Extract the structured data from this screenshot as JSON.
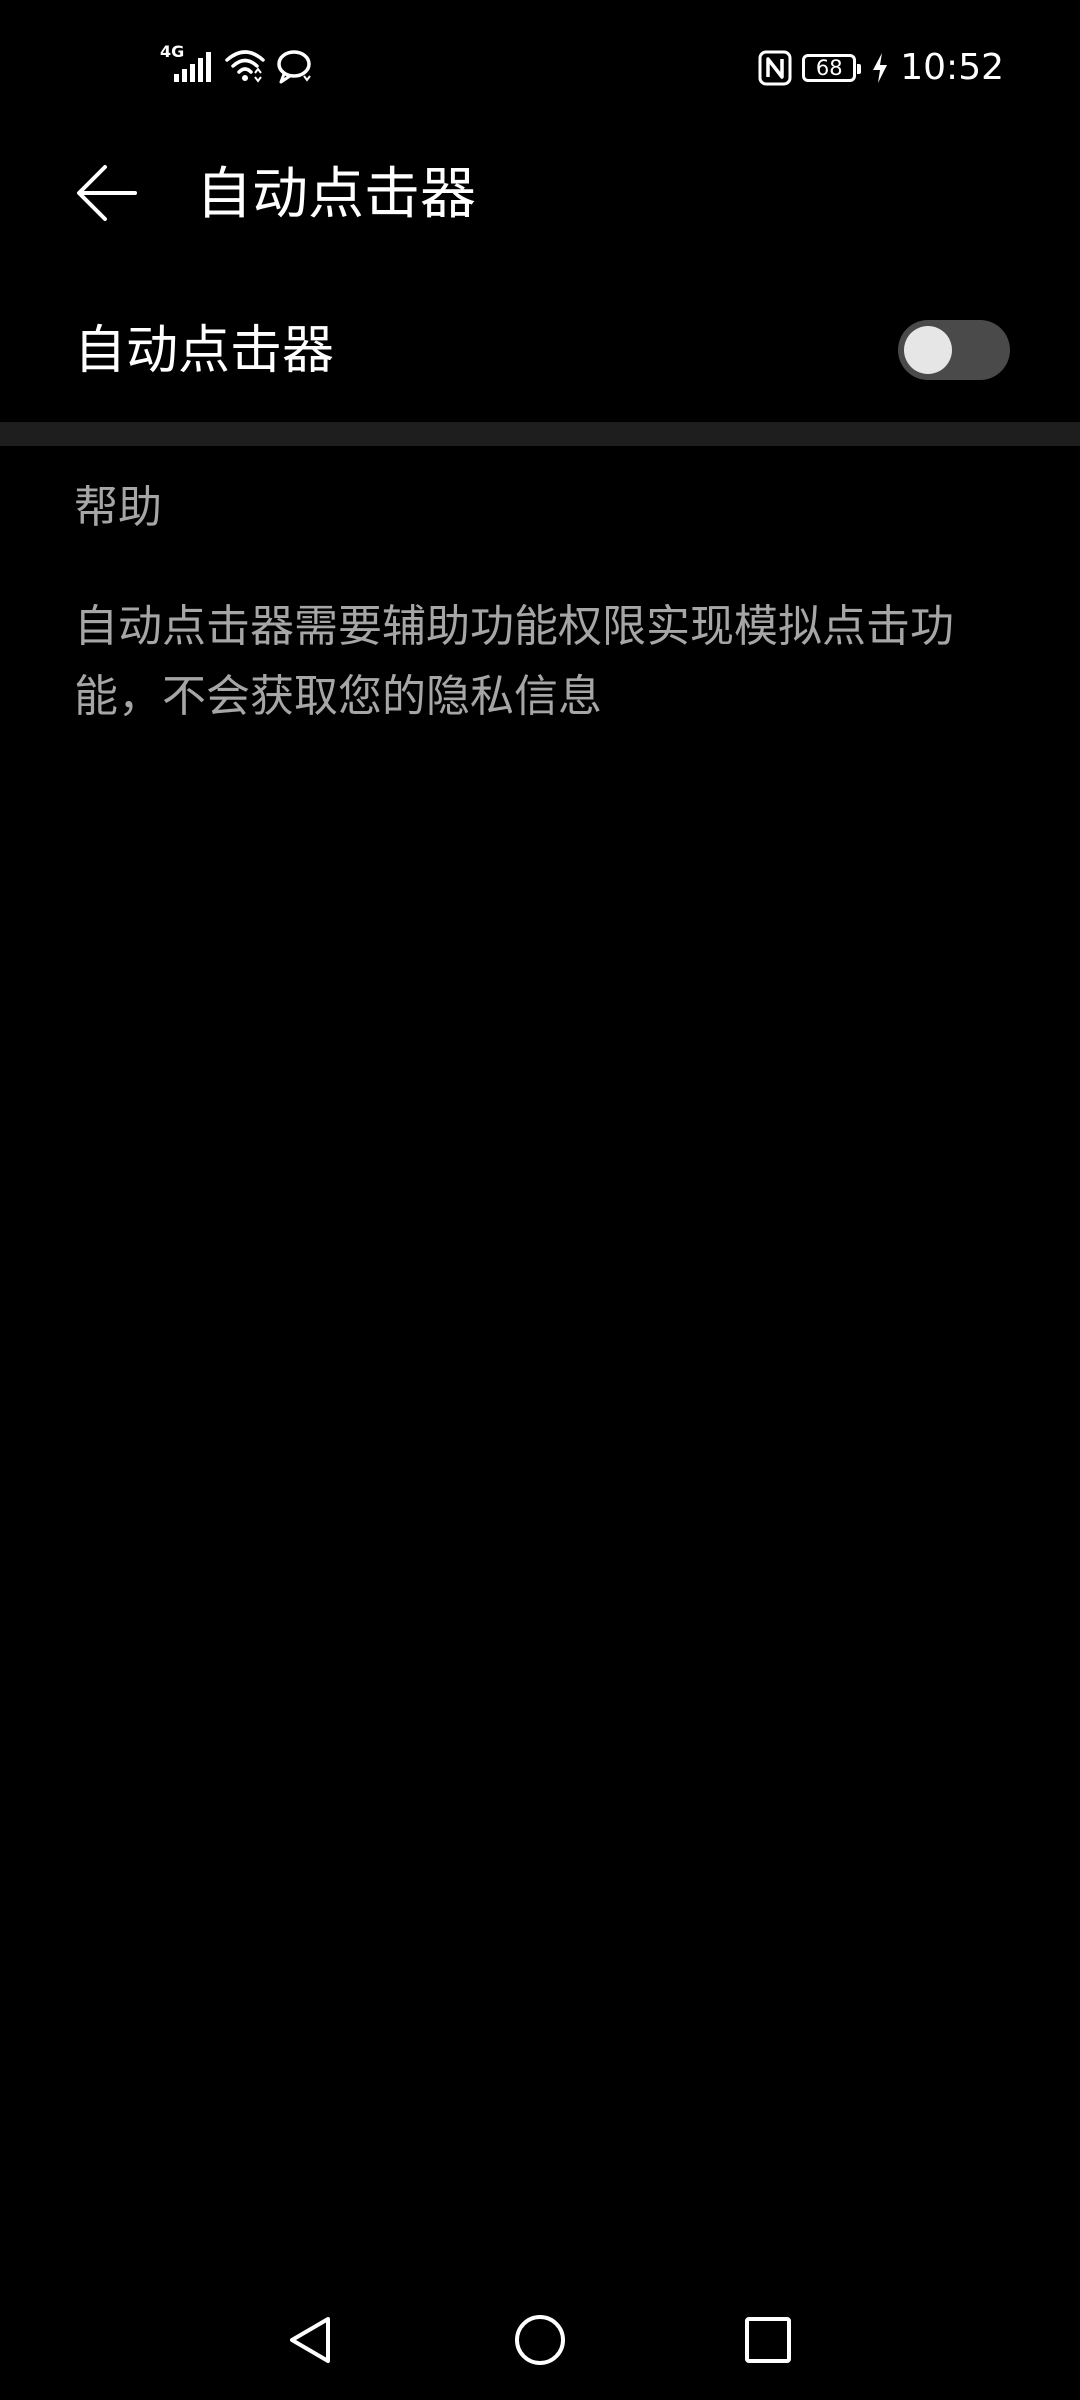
{
  "status_bar": {
    "network_type": "4G",
    "battery_level": "68",
    "time": "10:52",
    "icons": [
      "signal-icon",
      "wifi-icon",
      "hotspot-icon",
      "nfc-icon",
      "battery-icon",
      "charging-icon"
    ]
  },
  "app_bar": {
    "title": "自动点击器",
    "back_icon": "arrow-left-icon"
  },
  "settings": {
    "auto_clicker": {
      "label": "自动点击器",
      "enabled": false
    }
  },
  "help": {
    "header": "帮助",
    "text": "自动点击器需要辅助功能权限实现模拟点击功能，不会获取您的隐私信息"
  },
  "nav_bar": {
    "icons": [
      "back-triangle-icon",
      "home-circle-icon",
      "recents-square-icon"
    ]
  },
  "colors": {
    "background": "#000000",
    "primary_text": "#ffffff",
    "secondary_text": "#a6a6a6",
    "divider": "#1e1e1e",
    "switch_track_off": "#4a4a4a",
    "switch_thumb": "#e6e6e6"
  }
}
